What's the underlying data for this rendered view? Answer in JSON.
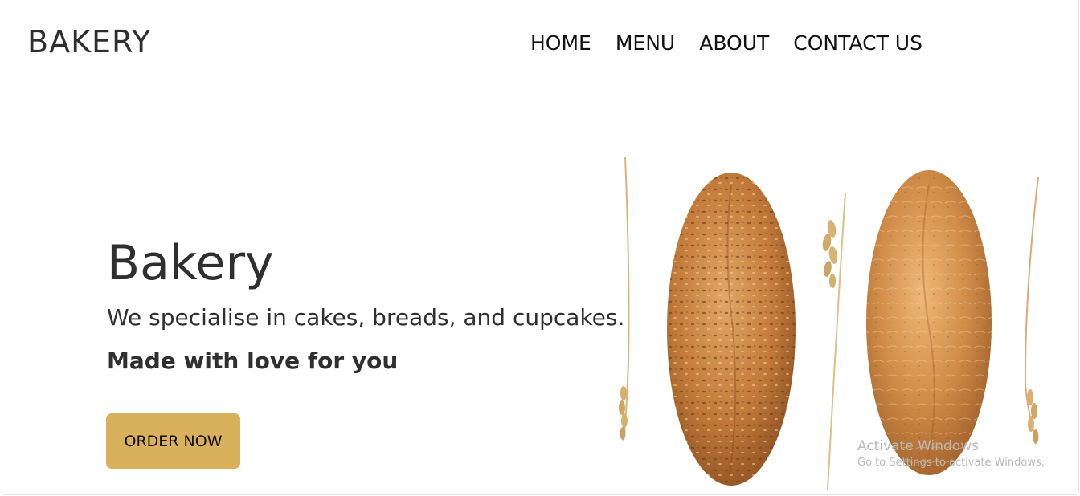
{
  "header": {
    "logo": "BAKERY",
    "nav": [
      {
        "label": "HOME"
      },
      {
        "label": "MENU"
      },
      {
        "label": "ABOUT"
      },
      {
        "label": "CONTACT US"
      }
    ]
  },
  "hero": {
    "title": "Bakery",
    "subtitle": "We specialise in cakes, breads, and cupcakes.",
    "tagline": "Made with love for you",
    "cta_label": "ORDER NOW",
    "image_icon": "bread-loaves-with-wheat-image"
  },
  "watermark": {
    "title": "Activate Windows",
    "subtitle": "Go to Settings to activate Windows."
  },
  "colors": {
    "button": "#d9b05c",
    "text": "#2f2f2f",
    "background": "#ffffff"
  }
}
